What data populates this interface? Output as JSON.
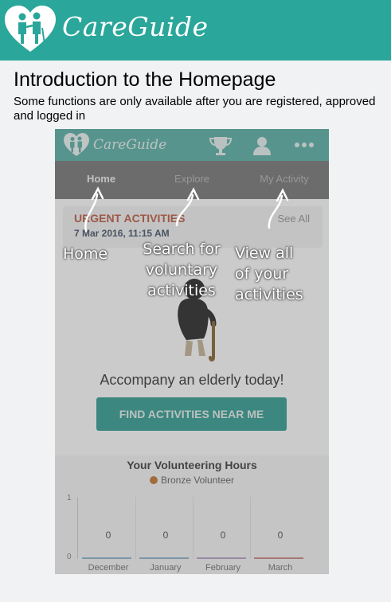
{
  "header": {
    "brand": "CareGuide"
  },
  "page": {
    "title": "Introduction to the Homepage",
    "subtitle": "Some functions are only available after you are registered, approved and logged in"
  },
  "phone": {
    "brand": "CareGuide",
    "icons": [
      "trophy-icon",
      "user-icon",
      "more-icon"
    ],
    "tabs": [
      {
        "label": "Home",
        "active": true
      },
      {
        "label": "Explore",
        "active": false
      },
      {
        "label": "My Activity",
        "active": false
      }
    ],
    "urgent": {
      "title": "URGENT ACTIVITIES",
      "date": "7 Mar 2016, 11:15 AM",
      "see_all": "See All"
    },
    "accompany_text": "Accompany an elderly today!",
    "find_button": "FIND ACTIVITIES NEAR ME",
    "hours": {
      "title": "Your Volunteering Hours",
      "badge": "Bronze Volunteer",
      "y_ticks": [
        "1",
        "0"
      ],
      "months": [
        {
          "label": "December",
          "value": "0"
        },
        {
          "label": "January",
          "value": "0"
        },
        {
          "label": "February",
          "value": "0"
        },
        {
          "label": "March",
          "value": "0"
        }
      ]
    }
  },
  "annotations": {
    "home": "Home",
    "explore": "Search for\nvoluntary\nactivities",
    "my_activity": "View all\nof your\nactivities"
  },
  "colors": {
    "brand_teal": "#2aa69a",
    "urgent_red": "#c0624a",
    "button_teal": "#3aa196"
  }
}
